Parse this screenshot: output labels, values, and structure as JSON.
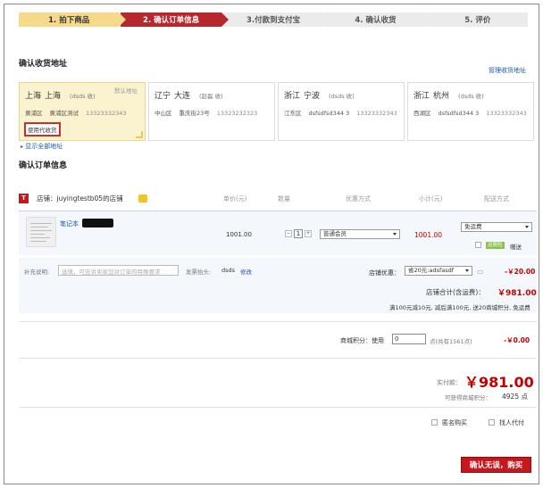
{
  "steps": [
    "1. 拍下商品",
    "2. 确认订单信息",
    "3.付款到支付宝",
    "4. 确认收货",
    "5. 评价"
  ],
  "address": {
    "title": "确认收货地址",
    "manage": "管理收货地址",
    "show_all": "显示全部地址",
    "cards": [
      {
        "province": "上海",
        "city": "上海",
        "receiver": "(dsds 收)",
        "district": "黄浦区",
        "street": "黄浦区测试",
        "phone": "13323332343",
        "default_label": "默认地址",
        "agent_label": "使用代收货"
      },
      {
        "province": "辽宁",
        "city": "大连",
        "receiver": "(赵磊 收)",
        "district": "中山区",
        "street": "重庆街23号",
        "phone": "13323232323"
      },
      {
        "province": "浙江",
        "city": "宁波",
        "receiver": "(dsds 收)",
        "district": "江东区",
        "street": "dsfsdfsd344 3",
        "phone": "13323332343"
      },
      {
        "province": "浙江",
        "city": "杭州",
        "receiver": "(dsds 收)",
        "district": "西湖区",
        "street": "dsfsdfsd344 3",
        "phone": "13323332343"
      }
    ]
  },
  "order": {
    "title": "确认订单信息",
    "shop": "店铺：juyingtestb05的店铺",
    "columns": {
      "unit_price": "单价(元)",
      "quantity": "数量",
      "discount": "优惠方式",
      "subtotal": "小计(元)",
      "shipping": "配送方式"
    },
    "item": {
      "name": "笔记本",
      "price": "1001.00",
      "quantity": "1",
      "discount": "普通会员",
      "subtotal": "1001.00",
      "shipping": "免运费",
      "gift_tag": "运费险",
      "gift_text": "赠送"
    },
    "remark_label": "补充说明:",
    "remark_placeholder": "选填，可告诉卖家您对订单的特殊要求",
    "invoice_label": "发票抬头:",
    "invoice_value": "dsds",
    "invoice_edit": "修改",
    "coupon_label": "店铺优惠：",
    "coupon_value": "省20元:adsfasdf",
    "coupon_amount": "-￥20.00",
    "shop_total_label": "店铺合计(含运费)：",
    "shop_total": "￥981.00",
    "promo_text": "满100元减10元, 减后满100元, 送20商城积分, 免运费",
    "points_label": "商城积分：使用",
    "points_value": "0",
    "points_available": "点(共有1561点)",
    "points_amount": "-￥0.00",
    "pay_label": "实付款：",
    "pay_total": "￥981.00",
    "earn_label": "可获得商城积分：",
    "earn_value": "4925 点",
    "anonymous": "匿名购买",
    "proxy_pay": "找人代付",
    "submit": "确认无误，购买"
  }
}
